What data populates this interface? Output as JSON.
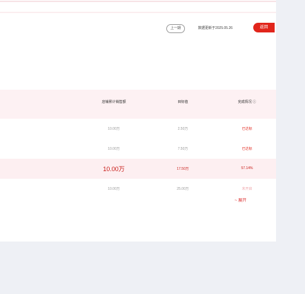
{
  "header": {
    "prev_label": "上一期",
    "update_note": "数据更新于2025.05.26",
    "close_label": "返回"
  },
  "table": {
    "columns": [
      "店铺累计销售额",
      "目标值",
      "完成情况"
    ],
    "rows": [
      {
        "sales": "10.00万",
        "target": "2.50万",
        "status": "已达标",
        "highlight": false
      },
      {
        "sales": "10.00万",
        "target": "7.50万",
        "status": "已达标",
        "highlight": false
      },
      {
        "sales": "10.00万",
        "target": "17.50万",
        "status": "57.14%",
        "highlight": true
      },
      {
        "sales": "10.00万",
        "target": "25.00万",
        "status": "未开启",
        "highlight": false
      }
    ]
  },
  "more_label": "~ 展开"
}
